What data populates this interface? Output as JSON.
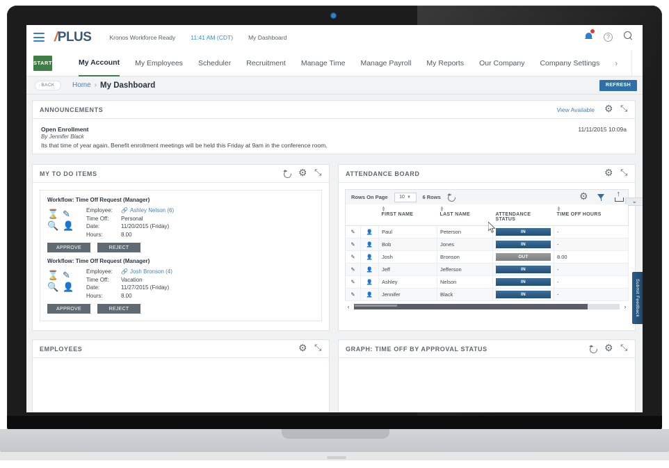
{
  "topbar": {
    "menu_icon": "hamburger-icon",
    "brand_slash": "/",
    "brand_text": "PLUS",
    "product": "Kronos Workforce Ready",
    "time": "11:41 AM (CDT)",
    "page": "My Dashboard",
    "notifications_icon": "bell-icon",
    "help_icon": "question-circle-icon",
    "search_icon": "search-icon"
  },
  "nav": {
    "start_label": "START",
    "items": [
      {
        "label": "My Account",
        "active": true
      },
      {
        "label": "My Employees",
        "active": false
      },
      {
        "label": "Scheduler",
        "active": false
      },
      {
        "label": "Recruitment",
        "active": false
      },
      {
        "label": "Manage Time",
        "active": false
      },
      {
        "label": "Manage Payroll",
        "active": false
      },
      {
        "label": "My Reports",
        "active": false
      },
      {
        "label": "Our Company",
        "active": false
      },
      {
        "label": "Company Settings",
        "active": false
      }
    ],
    "more_chevron": "›",
    "search_icon": "search-icon"
  },
  "breadcrumb": {
    "back_label": "BACK",
    "home": "Home",
    "separator": "›",
    "current": "My Dashboard",
    "refresh_label": "REFRESH"
  },
  "announcements": {
    "title": "ANNOUNCEMENTS",
    "view_available": "View Available",
    "item_title": "Open Enrollment",
    "item_author": "By Jennifer Black",
    "item_text": "Its that time of year again.  Benefit enrollment meetings will be held this Friday at 9am in the conference room.",
    "item_date": "11/11/2015 10:09a"
  },
  "todo": {
    "title": "MY TO DO ITEMS",
    "approve_label": "APPROVE",
    "reject_label": "REJECT",
    "labels": {
      "employee": "Employee:",
      "timeoff": "Time Off:",
      "date": "Date:",
      "hours": "Hours:"
    },
    "items": [
      {
        "workflow": "Workflow: Time Off Request (Manager)",
        "employee": "Ashley Nelson (6)",
        "timeoff": "Personal",
        "date": "11/20/2015 (Friday)",
        "hours": "8.00"
      },
      {
        "workflow": "Workflow: Time Off Request (Manager)",
        "employee": "Josh Bronson (4)",
        "timeoff": "Vacation",
        "date": "11/27/2015 (Friday)",
        "hours": "8.00"
      }
    ]
  },
  "attendance": {
    "title": "ATTENDANCE BOARD",
    "toolbar": {
      "rows_on_page_label": "Rows On Page",
      "rows_per_page": "10",
      "row_count": "6 Rows",
      "refresh_icon": "refresh-icon",
      "gear_icon": "gear-icon",
      "filter_icon": "funnel-icon",
      "export_icon": "export-icon"
    },
    "columns": [
      "FIRST NAME",
      "LAST NAME",
      "ATTENDANCE STATUS",
      "TIME OFF HOURS"
    ],
    "rows": [
      {
        "first": "Paul",
        "last": "Peterson",
        "status": "IN",
        "hours": "-"
      },
      {
        "first": "Bob",
        "last": "Jones",
        "status": "IN",
        "hours": "-"
      },
      {
        "first": "Josh",
        "last": "Bronson",
        "status": "OUT",
        "hours": "8.00"
      },
      {
        "first": "Jeff",
        "last": "Jefferson",
        "status": "IN",
        "hours": "-"
      },
      {
        "first": "Ashley",
        "last": "Nelson",
        "status": "IN",
        "hours": "-"
      },
      {
        "first": "Jennifer",
        "last": "Black",
        "status": "IN",
        "hours": "-"
      }
    ],
    "scroll_left": "‹",
    "scroll_right": "›"
  },
  "employees": {
    "title": "EMPLOYEES"
  },
  "graph": {
    "title": "GRAPH: TIME OFF BY APPROVAL STATUS"
  },
  "feedback": {
    "label": "Submit Feedback"
  },
  "colors": {
    "brand_orange": "#d8662a",
    "brand_navy": "#3a5a77",
    "start_green": "#3f7e44",
    "refresh_blue": "#2f6fa8",
    "link_blue": "#4a7fb5",
    "status_in": "#2b5d85",
    "status_out": "#8a8a8a",
    "badge_red": "#e03b30"
  }
}
